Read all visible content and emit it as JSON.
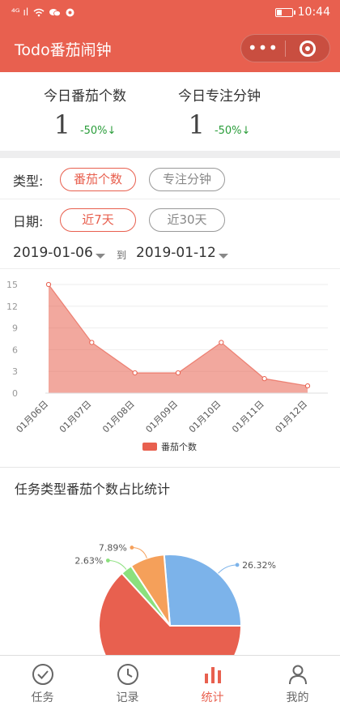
{
  "statusbar": {
    "left": "⁴ᴳ ıl",
    "time": "10:44"
  },
  "navbar": {
    "title": "Todo番茄闹钟",
    "more": "•••"
  },
  "stats": [
    {
      "label": "今日番茄个数",
      "value": "1",
      "change": "-50%↓"
    },
    {
      "label": "今日专注分钟",
      "value": "1",
      "change": "-50%↓"
    }
  ],
  "type_filter": {
    "label": "类型:",
    "options": [
      "番茄个数",
      "专注分钟"
    ],
    "selected": "番茄个数"
  },
  "date_filter": {
    "label": "日期:",
    "options": [
      "近7天",
      "近30天"
    ],
    "selected": "近7天"
  },
  "date_range": {
    "start": "2019-01-06",
    "to": "到",
    "end": "2019-01-12"
  },
  "chart_data": {
    "type": "area",
    "categories": [
      "01月06日",
      "01月07日",
      "01月08日",
      "01月09日",
      "01月10日",
      "01月11日",
      "01月12日"
    ],
    "series": [
      {
        "name": "番茄个数",
        "values": [
          15,
          7,
          2.8,
          2.8,
          7,
          2,
          1
        ]
      }
    ],
    "yticks": [
      0,
      3,
      6,
      9,
      12,
      15
    ],
    "ylim": [
      0,
      15
    ],
    "color": "#e8604f"
  },
  "pie_section": {
    "title": "任务类型番茄个数占比统计",
    "slices": [
      {
        "value": 26.32,
        "label": "26.32%",
        "color": "#7cb3ea"
      },
      {
        "value": 7.89,
        "label": "7.89%",
        "color": "#f5a05a"
      },
      {
        "value": 2.63,
        "label": "2.63%",
        "color": "#8be07d"
      },
      {
        "value": 63.16,
        "label": "",
        "color": "#e8604f"
      }
    ]
  },
  "tabs": [
    {
      "label": "任务",
      "icon": "check-circle-icon",
      "active": false
    },
    {
      "label": "记录",
      "icon": "clock-icon",
      "active": false
    },
    {
      "label": "统计",
      "icon": "bar-chart-icon",
      "active": true
    },
    {
      "label": "我的",
      "icon": "user-icon",
      "active": false
    }
  ]
}
